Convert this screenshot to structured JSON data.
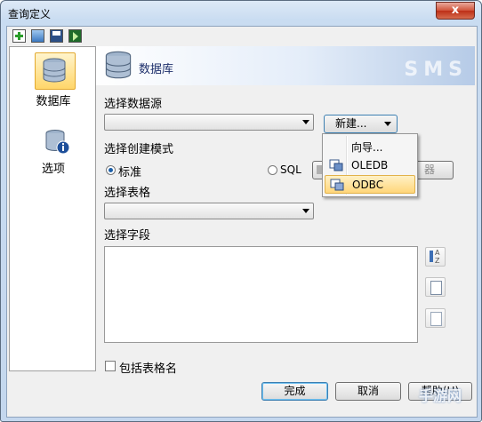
{
  "window": {
    "title": "查询定义",
    "close_glyph": "x"
  },
  "toolbar": {
    "icons": [
      "new-icon",
      "open-icon",
      "save-icon",
      "run-icon"
    ]
  },
  "nav": {
    "items": [
      {
        "label": "数据库",
        "icon": "database-icon",
        "selected": true
      },
      {
        "label": "选项",
        "icon": "database-info-icon",
        "selected": false
      }
    ]
  },
  "header": {
    "title": "数据库",
    "watermark": "SMS"
  },
  "form": {
    "datasource_label": "选择数据源",
    "datasource_value": "",
    "new_button": "新建...",
    "mode_label": "选择创建模式",
    "mode_options": [
      {
        "label": "标准",
        "checked": true
      },
      {
        "label": "SQL",
        "checked": false
      }
    ],
    "sql_button_partial": "器",
    "table_label": "选择表格",
    "table_value": "",
    "fields_label": "选择字段",
    "include_table_name": "包括表格名"
  },
  "menu": {
    "items": [
      {
        "label": "向导...",
        "icon": ""
      },
      {
        "label": "OLEDB",
        "icon": "oledb-icon"
      },
      {
        "label": "ODBC",
        "icon": "odbc-icon",
        "highlighted": true
      }
    ]
  },
  "footer": {
    "ok": "完成",
    "cancel": "取消",
    "help": "帮助(H)"
  },
  "overlay_watermark": "手游网"
}
